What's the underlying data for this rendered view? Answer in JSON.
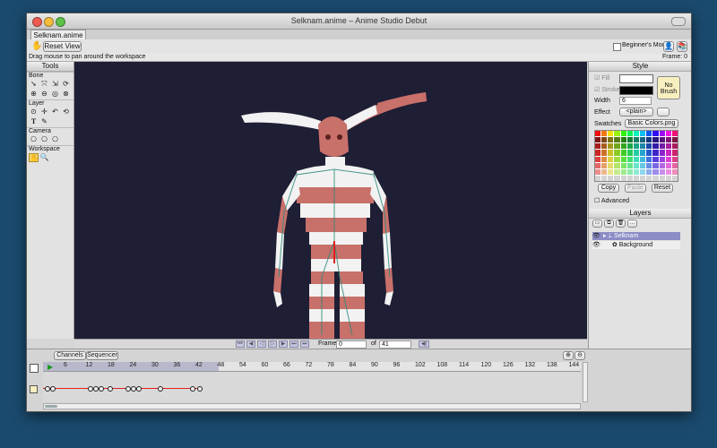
{
  "window": {
    "title": "Selknam.anime – Anime Studio Debut"
  },
  "doc_tab": "Selknam.anime",
  "toolbar": {
    "reset_view": "Reset View",
    "beginners_mode": "Beginner's Mode"
  },
  "status": {
    "hint": "Drag mouse to pan around the workspace",
    "frame": "Frame: 0"
  },
  "tools": {
    "title": "Tools",
    "sections": {
      "bone": "Bone",
      "layer": "Layer",
      "camera": "Camera",
      "workspace": "Workspace"
    }
  },
  "playback": {
    "frame_label": "Frame",
    "frame_value": "0",
    "of_label": "of",
    "total": "41"
  },
  "style": {
    "title": "Style",
    "fill": "Fill",
    "stroke": "Stroke",
    "width": "Width",
    "width_value": "6",
    "no_brush": "No Brush",
    "effect": "Effect",
    "effect_value": "<plain>",
    "swatches": "Swatches",
    "swatch_set": "Basic Colors.png",
    "copy": "Copy",
    "paste": "Paste",
    "reset": "Reset",
    "advanced": "Advanced"
  },
  "layers": {
    "title": "Layers",
    "items": [
      "Selknam",
      "Background"
    ]
  },
  "timeline": {
    "tabs": [
      "Channels",
      "Sequencer"
    ],
    "ticks": [
      "6",
      "12",
      "18",
      "24",
      "30",
      "36",
      "42",
      "48",
      "54",
      "60",
      "66",
      "72",
      "78",
      "84",
      "90",
      "96",
      "102",
      "108",
      "114",
      "120",
      "126",
      "132",
      "138",
      "144"
    ]
  },
  "colors": {
    "canvas": "#1e1e35",
    "body_red": "#c8706a",
    "body_white": "#f2f2f2",
    "selected_layer": "#8c8cc6"
  }
}
